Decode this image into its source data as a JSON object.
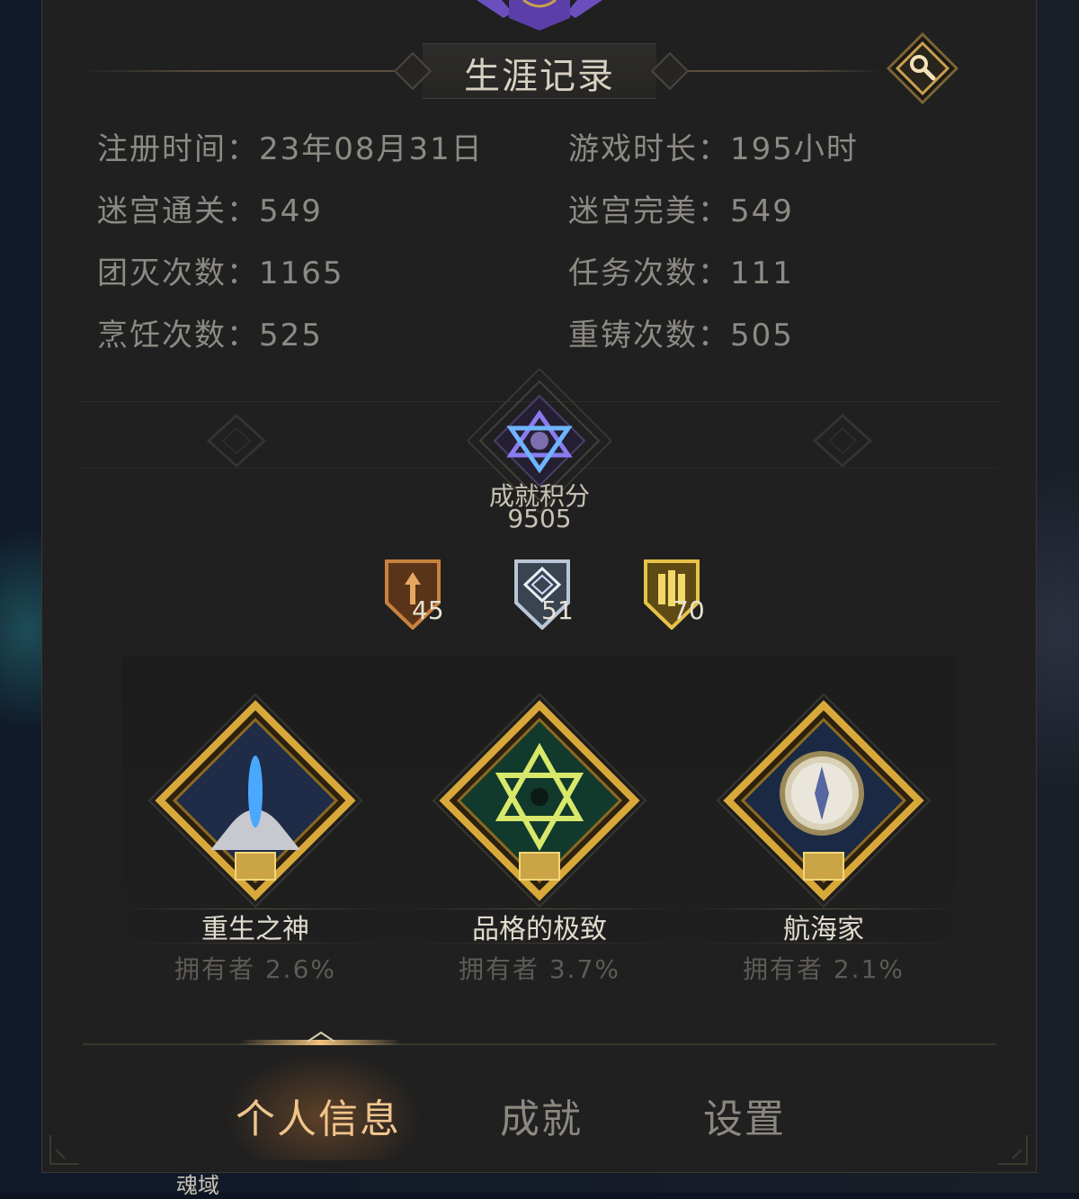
{
  "background": {
    "partial_label": "魂域"
  },
  "header": {
    "title": "生涯记录",
    "search_icon": "magnifier-icon"
  },
  "stats": [
    {
      "label": "注册时间：",
      "value": "23年08月31日"
    },
    {
      "label": "游戏时长：",
      "value": "195小时"
    },
    {
      "label": "迷宫通关：",
      "value": "549"
    },
    {
      "label": "迷宫完美：",
      "value": "549"
    },
    {
      "label": "团灭次数：",
      "value": "1165"
    },
    {
      "label": "任务次数：",
      "value": "111"
    },
    {
      "label": "烹饪次数：",
      "value": "525"
    },
    {
      "label": "重铸次数：",
      "value": "505"
    }
  ],
  "achievement": {
    "label": "成就积分",
    "score": "9505",
    "badges": [
      {
        "tier": "bronze",
        "count": "45",
        "color": "#c9823e"
      },
      {
        "tier": "silver",
        "count": "51",
        "color": "#b9c6d6"
      },
      {
        "tier": "gold",
        "count": "70",
        "color": "#e7c24a"
      }
    ]
  },
  "featured": [
    {
      "name": "重生之神",
      "owners": "拥有者 2.6%"
    },
    {
      "name": "品格的极致",
      "owners": "拥有者 3.7%"
    },
    {
      "name": "航海家",
      "owners": "拥有者 2.1%"
    }
  ],
  "tabs": [
    {
      "label": "个人信息",
      "active": true
    },
    {
      "label": "成就",
      "active": false
    },
    {
      "label": "设置",
      "active": false
    }
  ],
  "colors": {
    "panel": "#202020",
    "gold": "#d8a93a",
    "active_tab": "#f0c58c",
    "text_muted": "#8d8a84"
  }
}
